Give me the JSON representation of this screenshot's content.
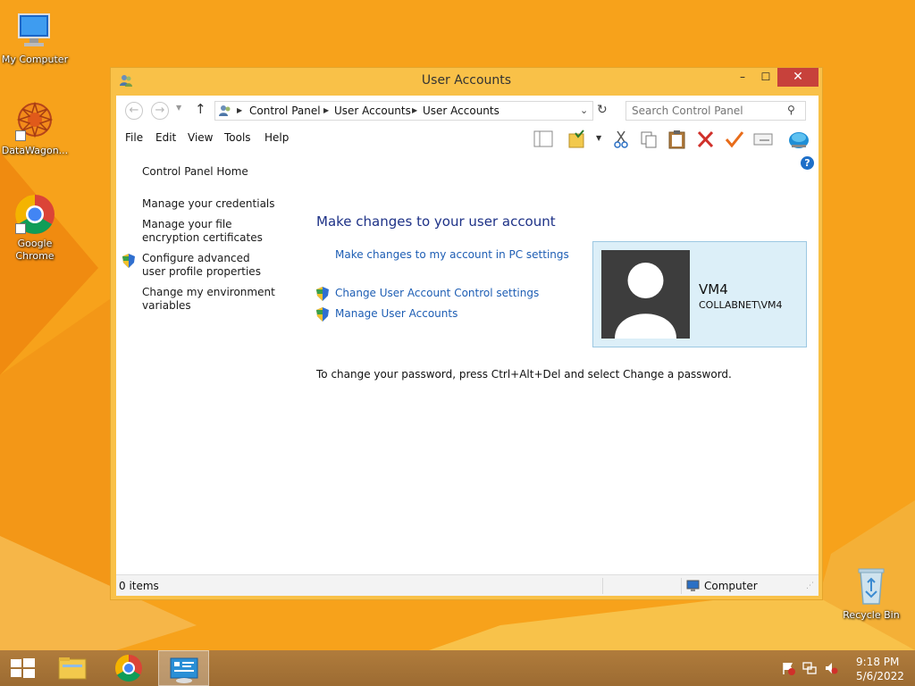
{
  "desktop": {
    "icons": [
      {
        "label": "My Computer"
      },
      {
        "label": "DataWagon..."
      },
      {
        "label": "Google Chrome"
      },
      {
        "label": "Recycle Bin"
      }
    ]
  },
  "window": {
    "title": "User Accounts",
    "controls": {
      "minimize": "–",
      "maximize": "☐",
      "close": "✕"
    }
  },
  "address": {
    "crumbs": [
      "Control Panel",
      "User Accounts",
      "User Accounts"
    ],
    "search_placeholder": "Search Control Panel"
  },
  "menu": [
    "File",
    "Edit",
    "View",
    "Tools",
    "Help"
  ],
  "left_pane": {
    "home": "Control Panel Home",
    "links": [
      "Manage your credentials",
      "Manage your file encryption certificates",
      "Configure advanced user profile properties",
      "Change my environment variables"
    ]
  },
  "main": {
    "title": "Make changes to your user account",
    "pc_settings_link": "Make changes to my account in PC settings",
    "uac_link": "Change User Account Control settings",
    "manage_link": "Manage User Accounts",
    "password_note": "To change your password, press Ctrl+Alt+Del and select Change a password."
  },
  "user": {
    "name": "VM4",
    "domain": "COLLABNET\\VM4"
  },
  "statusbar": {
    "items": "0 items",
    "location": "Computer"
  },
  "taskbar": {
    "time": "9:18 PM",
    "date": "5/6/2022"
  },
  "colors": {
    "desktop": "#f7a21b",
    "window_border": "#f9c148",
    "close_button": "#c7413b",
    "link": "#1e5eb4",
    "heading": "#1e3287"
  }
}
